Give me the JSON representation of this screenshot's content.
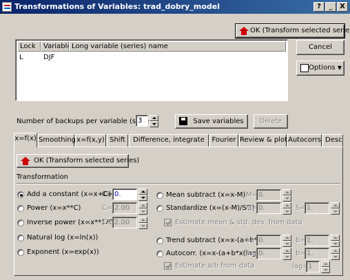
{
  "window": {
    "title": "Transformations of Variables: trad_dobry_model",
    "help": "?",
    "minimize": "_",
    "close": "X"
  },
  "top_buttons": {
    "ok": "OK (Transform selected series)",
    "cancel": "Cancel",
    "options": "Options"
  },
  "variable_list": {
    "headers": [
      "Lock",
      "Variable",
      "Long variable (series) name"
    ],
    "rows": [
      {
        "lock": "L",
        "variable": "DJF",
        "long_name": ""
      }
    ]
  },
  "backups": {
    "label": "Number of backups per variable (series):",
    "value": "3",
    "save": "Save variables",
    "delete": "Delete"
  },
  "tabs": [
    "x=f(x)",
    "Smoothing",
    "x=f(x,y)",
    "Shift",
    "Difference, integrate",
    "Fourier",
    "Review & plot",
    "Autocorrs",
    "Descriptives"
  ],
  "active_tab": "x=f(x)",
  "panel": {
    "ok": "OK (Transform selected series)",
    "group_label": "Transformation",
    "left": [
      {
        "label": "Add a constant (x=x+C)",
        "param_label": "C=",
        "param_value": "0.",
        "selected": true
      },
      {
        "label": "Power (x=x**C)",
        "param_label": "C=",
        "param_value": "2.00",
        "selected": false
      },
      {
        "label": "Inverse power (x=x**1/C)",
        "param_label": "C=",
        "param_value": "2.00",
        "selected": false
      },
      {
        "label": "Natural log (x=ln(x))",
        "selected": false
      },
      {
        "label": "Exponent (x=exp(x))",
        "selected": false
      }
    ],
    "right": {
      "mean_subtract": {
        "label": "Mean subtract (x=x-M)",
        "m_label": "M=",
        "m_value": "0."
      },
      "standardize": {
        "label": "Standardize (x=(x-M)/SD)",
        "m_label": "M=",
        "m_value": "0.",
        "s_label": "S=",
        "s_value": "1."
      },
      "estimate_mean": "Estimate mean & std. dev. from data",
      "trend_subtract": {
        "label": "Trend subtract (x=x-(a+b*t))",
        "a_label": "a=",
        "a_value": "0.",
        "b_label": "b=",
        "b_value": "1."
      },
      "autocorr": {
        "label": "Autocorr. (x=x-(a+b*x(lag)))",
        "a_label": "a=",
        "a_value": "0.",
        "b_label": "b=",
        "b_value": "1."
      },
      "estimate_ab": "Estimate a/b from data",
      "lag_label": "lag=",
      "lag_value": "1"
    }
  }
}
